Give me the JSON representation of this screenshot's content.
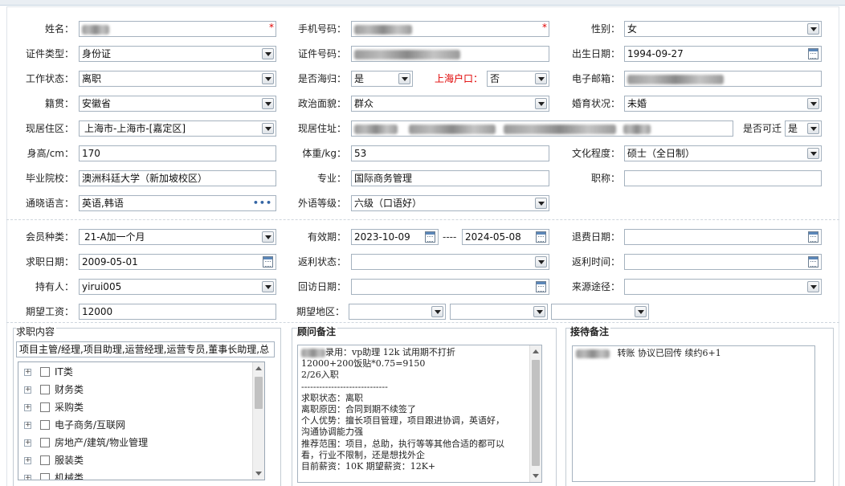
{
  "fields": {
    "name_label": "姓名：",
    "phone_label": "手机号码：",
    "gender_label": "性别：",
    "gender_value": "女",
    "idtype_label": "证件类型：",
    "idtype_value": "身份证",
    "idno_label": "证件号码：",
    "birth_label": "出生日期：",
    "birth_value": "1994-09-27",
    "workstatus_label": "工作状态：",
    "workstatus_value": "离职",
    "returnee_label": "是否海归：",
    "returnee_value": "是",
    "shhukou_label": "上海户口：",
    "shhukou_value": "否",
    "email_label": "电子邮箱：",
    "native_label": "籍贯：",
    "native_value": "安徽省",
    "political_label": "政治面貌：",
    "political_value": "群众",
    "marital_label": "婚育状况：",
    "marital_value": "未婚",
    "residence_label": "现居住区：",
    "residence_value": "上海市-上海市-[嘉定区]",
    "address_label": "现居住址：",
    "relocate_label": "是否可迁",
    "relocate_value": "是",
    "height_label": "身高/cm：",
    "height_value": "170",
    "weight_label": "体重/kg：",
    "weight_value": "53",
    "education_label": "文化程度：",
    "education_value": "硕士（全日制）",
    "school_label": "毕业院校：",
    "school_value": "澳洲科廷大学（新加坡校区）",
    "major_label": "专业：",
    "major_value": "国际商务管理",
    "title_label": "职称：",
    "language_label": "通晓语言：",
    "language_value": "英语,韩语",
    "language_button": "•••",
    "foreignlevel_label": "外语等级：",
    "foreignlevel_value": "六级（口语好）"
  },
  "membership": {
    "type_label": "会员种类：",
    "type_value": "21-A加一个月",
    "valid_label": "有效期：",
    "valid_start": "2023-10-09",
    "valid_sep": "----",
    "valid_end": "2024-05-08",
    "refund_label": "退费日期：",
    "jobdate_label": "求职日期：",
    "jobdate_value": "2009-05-01",
    "rebate_status_label": "返利状态：",
    "rebate_time_label": "返利时间：",
    "holder_label": "持有人：",
    "holder_value": "yirui005",
    "visit_label": "回访日期：",
    "source_label": "来源途径：",
    "salary_label": "期望工资：",
    "salary_value": "12000",
    "area_label": "期望地区："
  },
  "job_content": {
    "title": "求职内容",
    "summary": "项目主管/经理,项目助理,运营经理,运营专员,董事长助理,总",
    "categories": [
      "IT类",
      "财务类",
      "采购类",
      "电子商务/互联网",
      "房地产/建筑/物业管理",
      "服装类",
      "机械类"
    ]
  },
  "advisor_notes": {
    "title": "顾问备注",
    "lines": [
      "录用：vp助理 12k 试用期不打折",
      "12000+200饭贴*0.75=9150",
      "2/26入职",
      "-----------------------------",
      "求职状态：离职",
      "离职原因：合同到期不续签了",
      "个人优势：擅长项目管理，项目跟进协调，英语好，",
      "沟通协调能力强",
      "推荐范围：项目，总助，执行等等其他合适的都可以",
      "看，行业不限制，还是想找外企",
      "目前薪资：10K   期望薪资：12K+"
    ]
  },
  "reception_notes": {
    "title": "接待备注",
    "text": "转账 协议已回传 续约6+1"
  },
  "icons": {
    "dropdown": "chevron-down-icon",
    "calendar": "calendar-icon",
    "more": "ellipsis-icon",
    "expand": "plus-icon"
  },
  "colors": {
    "required": "#e00000",
    "border": "#a5b2bf"
  }
}
